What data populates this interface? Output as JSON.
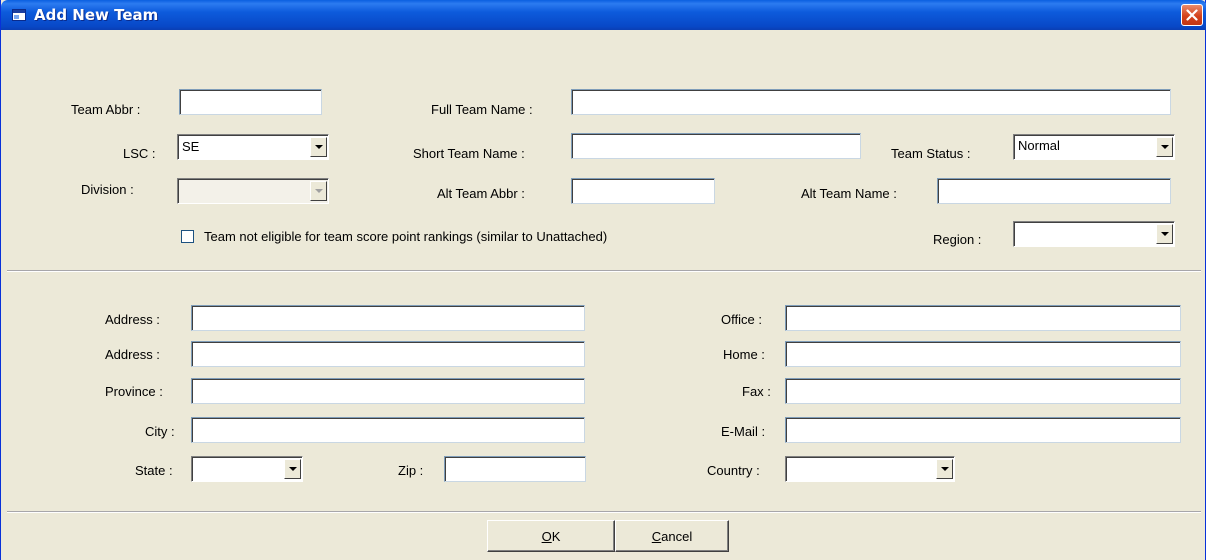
{
  "window": {
    "title": "Add New Team"
  },
  "icons": {
    "app": "window-app-icon",
    "close": "close-x-icon",
    "dropdown": "chevron-down-icon"
  },
  "team": {
    "team_abbr_label": "Team Abbr :",
    "team_abbr_value": "",
    "full_name_label": "Full Team Name :",
    "full_name_value": "",
    "lsc_label": "LSC :",
    "lsc_value": "SE",
    "short_name_label": "Short Team Name :",
    "short_name_value": "",
    "status_label": "Team Status :",
    "status_value": "Normal",
    "division_label": "Division :",
    "division_value": "",
    "alt_abbr_label": "Alt Team Abbr :",
    "alt_abbr_value": "",
    "alt_name_label": "Alt Team Name :",
    "alt_name_value": "",
    "not_eligible_label": "Team not eligible for team score point rankings (similar to Unattached)",
    "not_eligible_checked": false,
    "region_label": "Region :",
    "region_value": ""
  },
  "contact": {
    "address1_label": "Address :",
    "address2_label": "Address :",
    "province_label": "Province :",
    "city_label": "City :",
    "state_label": "State :",
    "state_value": "",
    "zip_label": "Zip :",
    "office_label": "Office :",
    "home_label": "Home :",
    "fax_label": "Fax :",
    "email_label": "E-Mail :",
    "country_label": "Country :",
    "country_value": ""
  },
  "buttons": {
    "ok_mnemonic": "O",
    "ok_rest": "K",
    "cancel_mnemonic": "C",
    "cancel_rest": "ancel"
  },
  "colors": {
    "titlebar": "#0848C7",
    "face": "#ECE9D8",
    "close": "#D4421C"
  }
}
